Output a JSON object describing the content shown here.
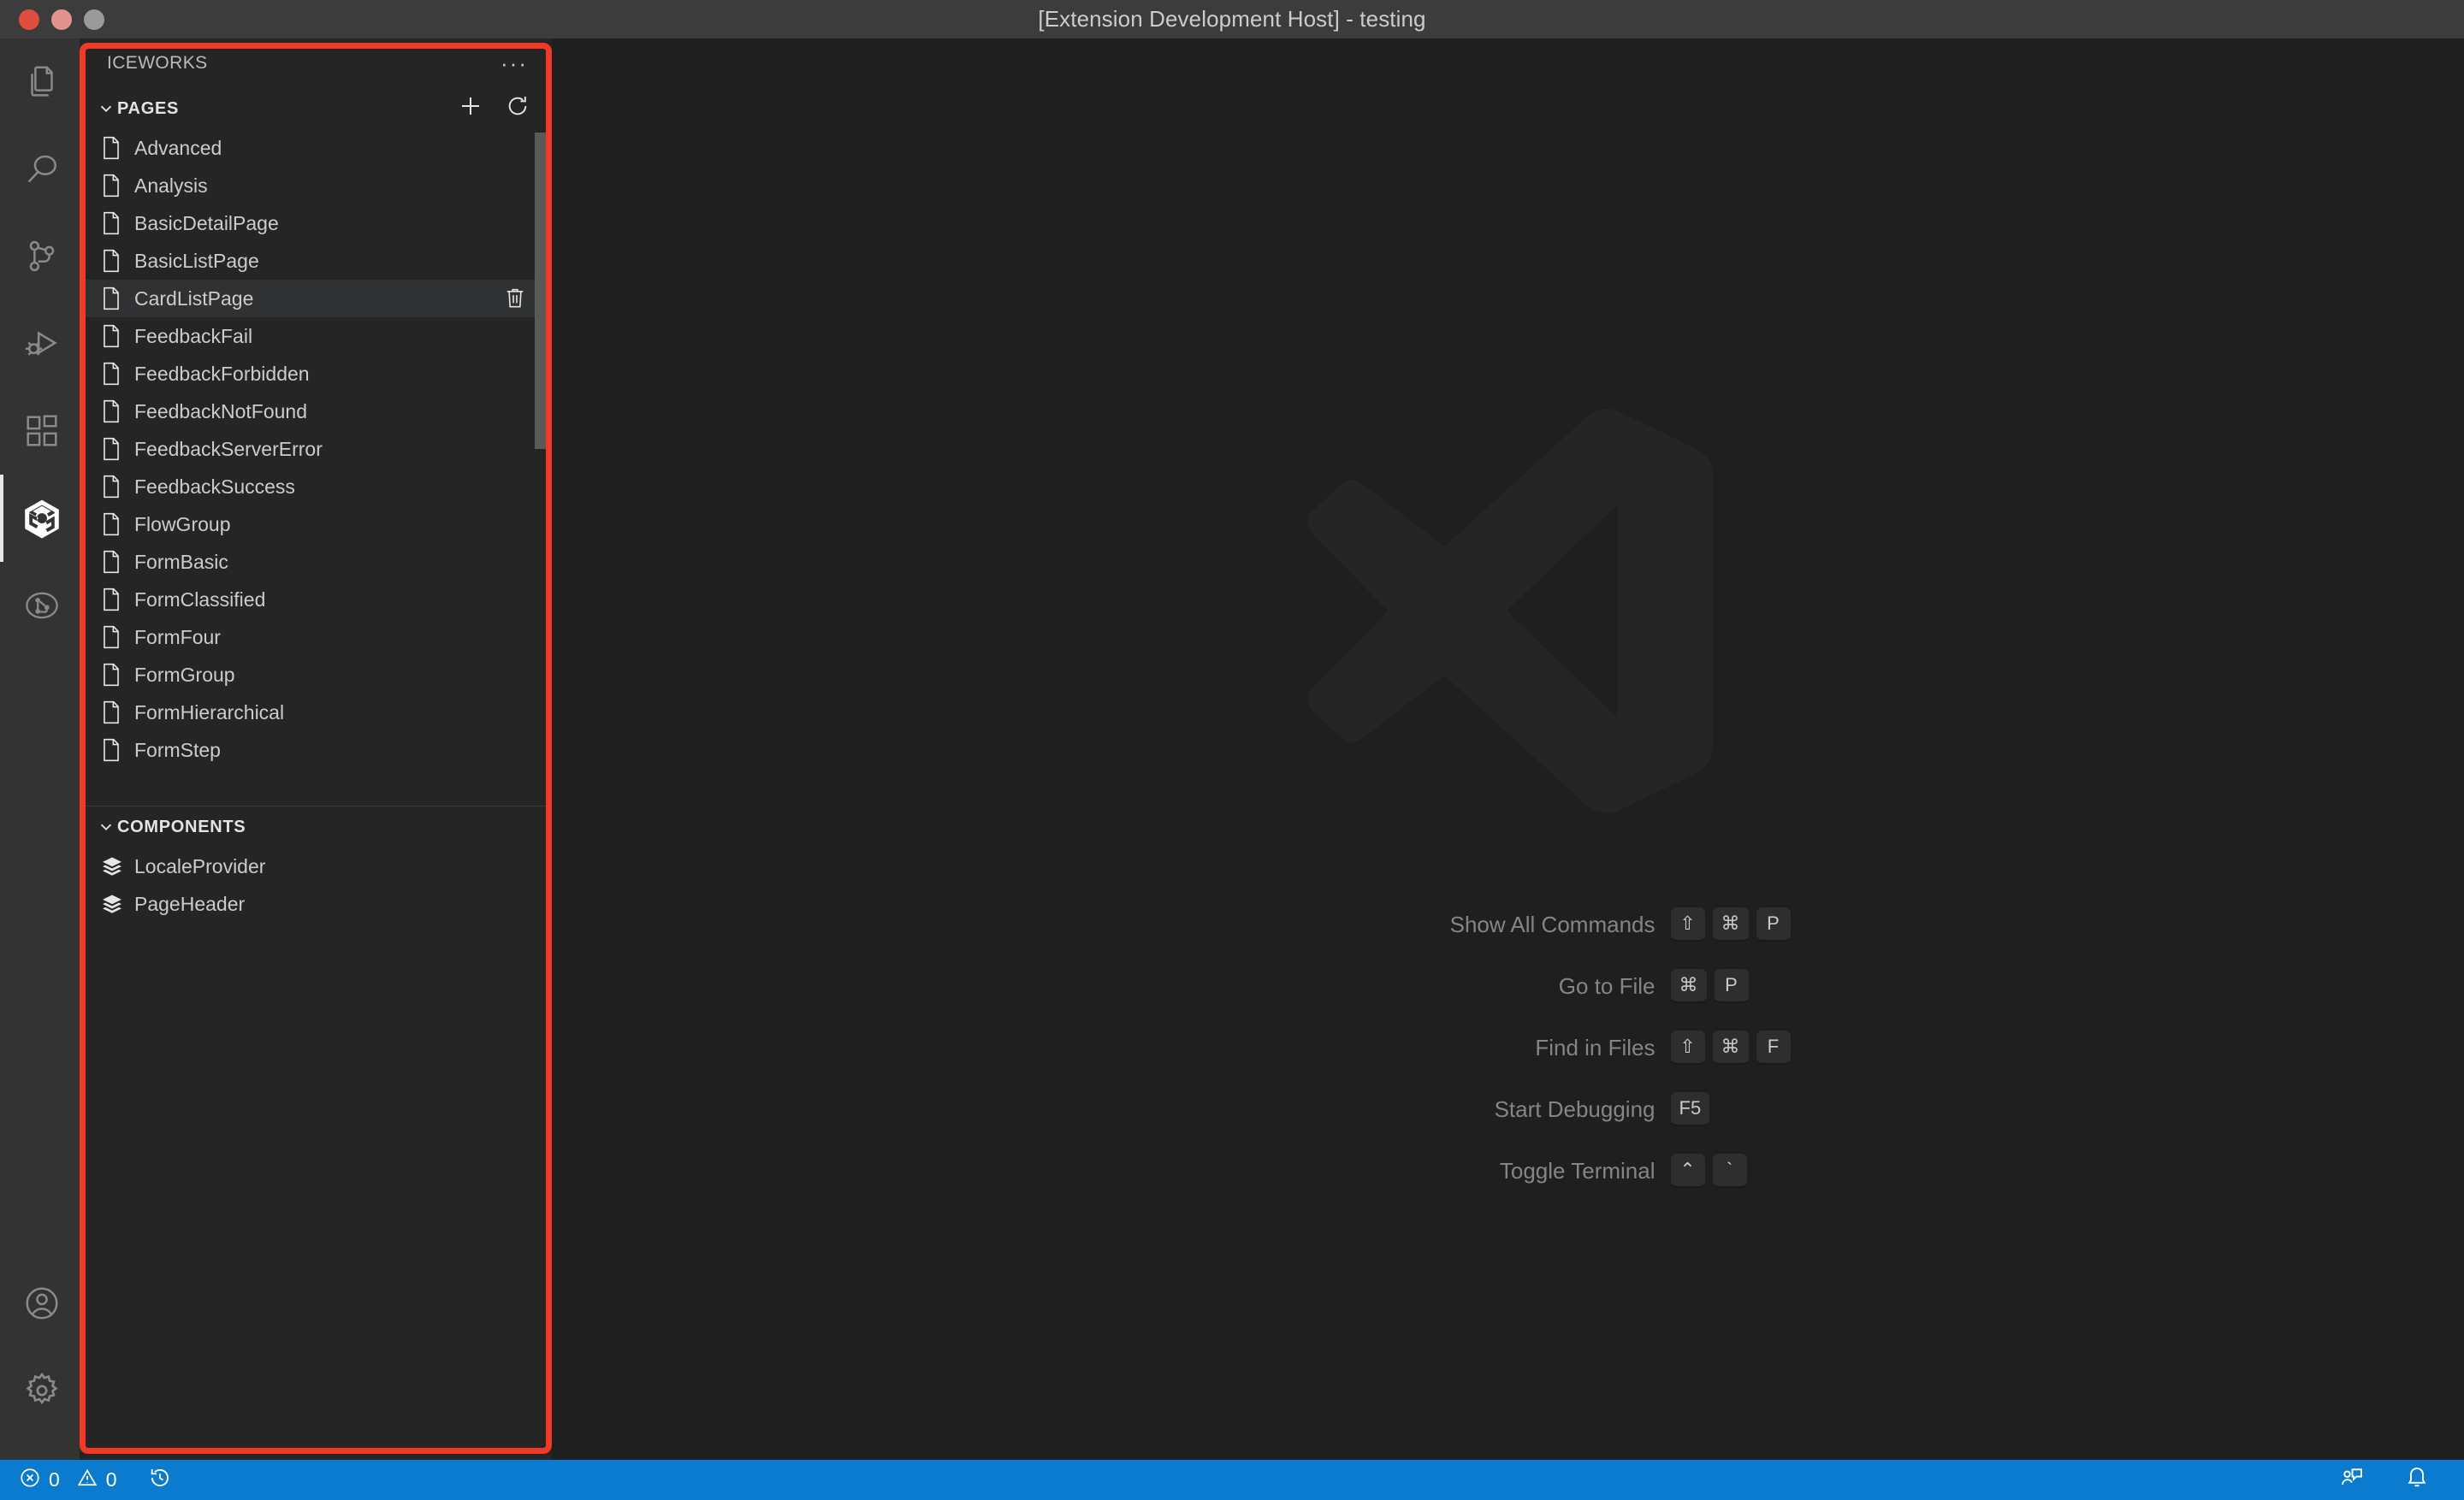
{
  "window": {
    "title": "[Extension Development Host] - testing",
    "traffic_lights": [
      "close-button",
      "minimize-button",
      "maximize-button"
    ]
  },
  "activity_bar": {
    "top_items": [
      {
        "name": "explorer",
        "icon": "files-icon",
        "active": false
      },
      {
        "name": "search",
        "icon": "search-icon",
        "active": false
      },
      {
        "name": "source-control",
        "icon": "source-control-icon",
        "active": false
      },
      {
        "name": "run-debug",
        "icon": "run-debug-icon",
        "active": false
      },
      {
        "name": "extensions",
        "icon": "extensions-icon",
        "active": false
      },
      {
        "name": "iceworks",
        "icon": "iceworks-icon",
        "active": true
      },
      {
        "name": "git-graph",
        "icon": "git-graph-icon",
        "active": false
      }
    ],
    "bottom_items": [
      {
        "name": "accounts",
        "icon": "account-icon",
        "active": false
      },
      {
        "name": "settings",
        "icon": "gear-icon",
        "active": false
      }
    ]
  },
  "sidebar": {
    "title": "ICEWORKS",
    "more_actions_label": "···",
    "sections": [
      {
        "id": "pages",
        "label": "PAGES",
        "expanded": true,
        "actions": [
          {
            "name": "add-page-button",
            "icon": "plus-icon"
          },
          {
            "name": "refresh-pages-button",
            "icon": "refresh-icon"
          }
        ],
        "items": [
          {
            "label": "Advanced",
            "icon": "file-icon",
            "selected": false
          },
          {
            "label": "Analysis",
            "icon": "file-icon",
            "selected": false
          },
          {
            "label": "BasicDetailPage",
            "icon": "file-icon",
            "selected": false
          },
          {
            "label": "BasicListPage",
            "icon": "file-icon",
            "selected": false
          },
          {
            "label": "CardListPage",
            "icon": "file-icon",
            "selected": true
          },
          {
            "label": "FeedbackFail",
            "icon": "file-icon",
            "selected": false
          },
          {
            "label": "FeedbackForbidden",
            "icon": "file-icon",
            "selected": false
          },
          {
            "label": "FeedbackNotFound",
            "icon": "file-icon",
            "selected": false
          },
          {
            "label": "FeedbackServerError",
            "icon": "file-icon",
            "selected": false
          },
          {
            "label": "FeedbackSuccess",
            "icon": "file-icon",
            "selected": false
          },
          {
            "label": "FlowGroup",
            "icon": "file-icon",
            "selected": false
          },
          {
            "label": "FormBasic",
            "icon": "file-icon",
            "selected": false
          },
          {
            "label": "FormClassified",
            "icon": "file-icon",
            "selected": false
          },
          {
            "label": "FormFour",
            "icon": "file-icon",
            "selected": false
          },
          {
            "label": "FormGroup",
            "icon": "file-icon",
            "selected": false
          },
          {
            "label": "FormHierarchical",
            "icon": "file-icon",
            "selected": false
          },
          {
            "label": "FormStep",
            "icon": "file-icon",
            "selected": false
          }
        ]
      },
      {
        "id": "components",
        "label": "COMPONENTS",
        "expanded": true,
        "actions": [],
        "items": [
          {
            "label": "LocaleProvider",
            "icon": "layers-icon",
            "selected": false
          },
          {
            "label": "PageHeader",
            "icon": "layers-icon",
            "selected": false
          }
        ]
      }
    ]
  },
  "editor": {
    "watermark_icon": "vscode-logo-icon",
    "shortcuts": [
      {
        "label": "Show All Commands",
        "keys": [
          "⇧",
          "⌘",
          "P"
        ]
      },
      {
        "label": "Go to File",
        "keys": [
          "⌘",
          "P"
        ]
      },
      {
        "label": "Find in Files",
        "keys": [
          "⇧",
          "⌘",
          "F"
        ]
      },
      {
        "label": "Start Debugging",
        "keys": [
          "F5"
        ]
      },
      {
        "label": "Toggle Terminal",
        "keys": [
          "⌃",
          "`"
        ]
      }
    ]
  },
  "status_bar": {
    "errors": "0",
    "warnings": "0",
    "left_icons": [
      "error-icon",
      "warning-icon",
      "history-icon"
    ],
    "right_icons": [
      "feedback-icon",
      "bell-icon"
    ]
  },
  "annotation": {
    "color": "#f03a26"
  }
}
